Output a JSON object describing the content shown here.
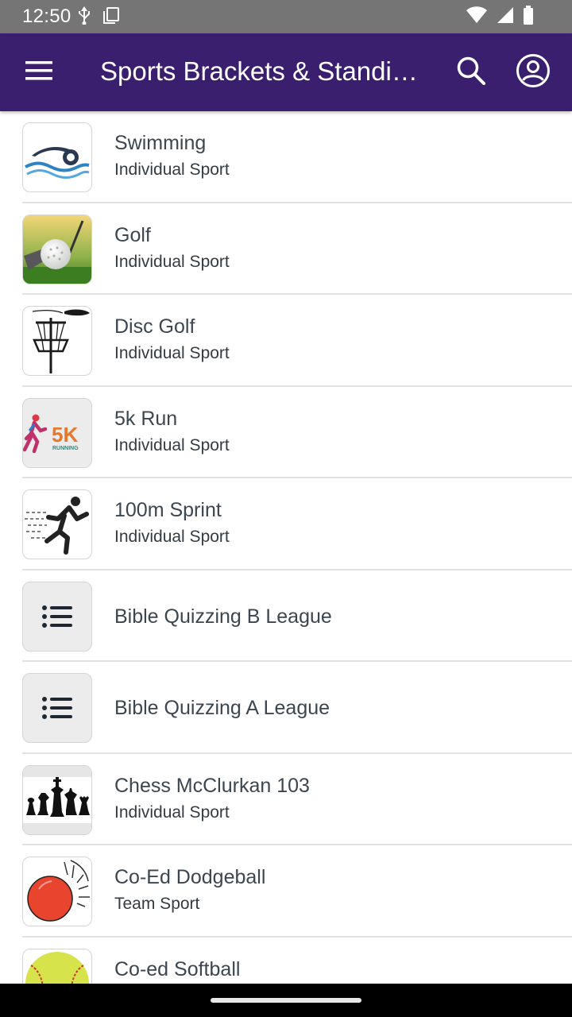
{
  "status_bar": {
    "time": "12:50",
    "left_icons": [
      "usb-debug-icon",
      "screenshot-icon"
    ],
    "right_icons": [
      "wifi-icon",
      "cellular-signal-icon",
      "battery-icon"
    ]
  },
  "app_bar": {
    "title": "Sports Brackets & Standings",
    "background_color": "#3a1f6f",
    "icons": [
      "menu-icon",
      "search-icon",
      "account-circle-icon"
    ]
  },
  "sports": [
    {
      "name": "Swimming",
      "type": "Individual Sport",
      "icon": "swimmer-icon"
    },
    {
      "name": "Golf",
      "type": "Individual Sport",
      "icon": "golf-ball-icon"
    },
    {
      "name": "Disc Golf",
      "type": "Individual Sport",
      "icon": "disc-golf-basket-icon"
    },
    {
      "name": "5k Run",
      "type": "Individual Sport",
      "icon": "5k-running-icon",
      "icon_text": "5K",
      "icon_subtext": "RUNNING"
    },
    {
      "name": "100m Sprint",
      "type": "Individual Sport",
      "icon": "sprinter-icon"
    },
    {
      "name": "Bible Quizzing B League",
      "type": "",
      "icon": "list-icon"
    },
    {
      "name": "Bible Quizzing A League",
      "type": "",
      "icon": "list-icon"
    },
    {
      "name": "Chess McClurkan 103",
      "type": "Individual Sport",
      "icon": "chess-pieces-icon"
    },
    {
      "name": "Co-Ed Dodgeball",
      "type": "Team Sport",
      "icon": "dodgeball-icon"
    },
    {
      "name": "Co-ed Softball",
      "type": "",
      "icon": "softball-icon"
    }
  ]
}
